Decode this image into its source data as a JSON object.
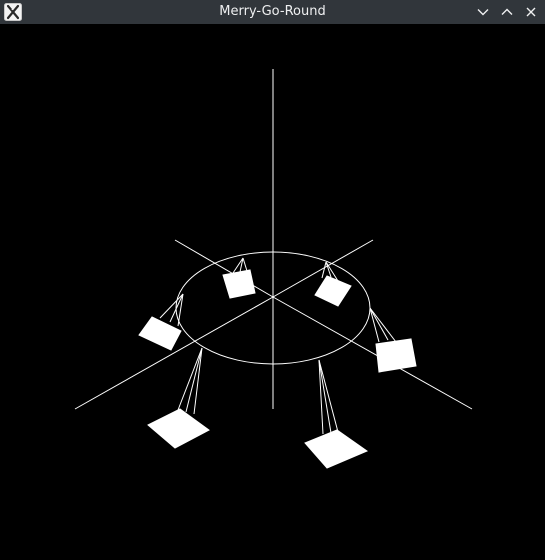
{
  "window": {
    "title": "Merry-Go-Round",
    "app_icon": "x-window-icon",
    "controls": [
      {
        "name": "minimize-button",
        "icon": "chevron-down-icon"
      },
      {
        "name": "maximize-button",
        "icon": "chevron-up-icon"
      },
      {
        "name": "close-button",
        "icon": "close-icon"
      }
    ]
  },
  "scene": {
    "background": "#000000",
    "line_color": "#ffffff",
    "seat_count": 6
  }
}
